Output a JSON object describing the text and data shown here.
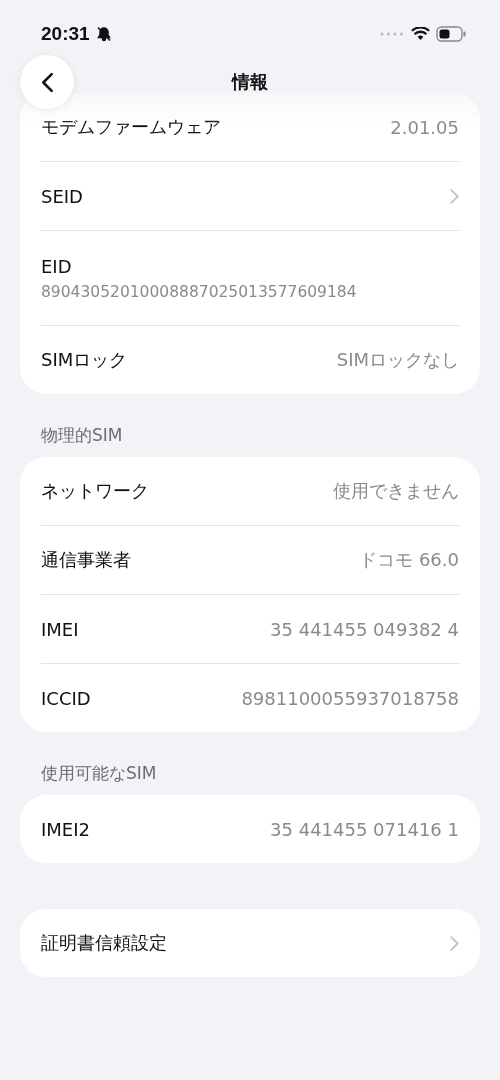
{
  "status_bar": {
    "time": "20:31"
  },
  "header": {
    "title": "情報"
  },
  "groups": [
    {
      "rows": [
        {
          "kind": "value",
          "label": "モデムファームウェア",
          "value": "2.01.05"
        },
        {
          "kind": "chevron",
          "label": "SEID"
        },
        {
          "kind": "stacked",
          "label": "EID",
          "value": "89043052010008887025013577609184"
        },
        {
          "kind": "value",
          "label": "SIMロック",
          "value": "SIMロックなし"
        }
      ]
    },
    {
      "title": "物理的SIM",
      "rows": [
        {
          "kind": "value",
          "label": "ネットワーク",
          "value": "使用できません"
        },
        {
          "kind": "value",
          "label": "通信事業者",
          "value": "ドコモ 66.0"
        },
        {
          "kind": "value",
          "label": "IMEI",
          "value": "35 441455 049382 4"
        },
        {
          "kind": "value",
          "label": "ICCID",
          "value": "8981100055937018758"
        }
      ]
    },
    {
      "title": "使用可能なSIM",
      "rows": [
        {
          "kind": "value",
          "label": "IMEI2",
          "value": "35 441455 071416 1"
        }
      ]
    },
    {
      "rows": [
        {
          "kind": "chevron",
          "label": "証明書信頼設定"
        }
      ]
    }
  ]
}
